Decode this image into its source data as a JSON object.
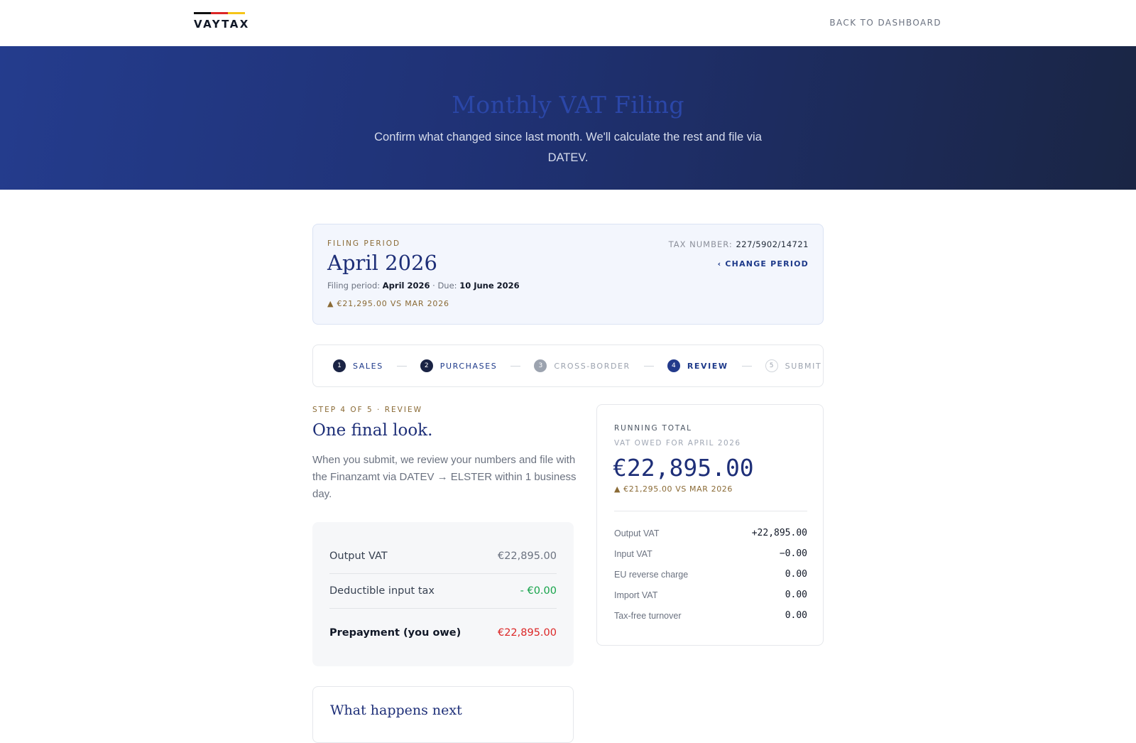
{
  "brand": {
    "name": "VAYTAX",
    "stripe_colors": [
      "#111111",
      "#dc2626",
      "#f5c518"
    ]
  },
  "nav": {
    "back_label": "BACK TO DASHBOARD"
  },
  "hero": {
    "title": "Monthly VAT Filing",
    "subtitle": "Confirm what changed since last month. We'll calculate the rest and file via DATEV."
  },
  "period": {
    "eyebrow": "FILING PERIOD",
    "title": "April 2026",
    "meta_label_period": "Filing period:",
    "meta_value_period": "April 2026",
    "meta_sep": "·",
    "meta_label_due": "Due:",
    "meta_value_due": "10 June 2026",
    "delta": "▲ €21,295.00 VS MAR 2026",
    "tax_number_label": "TAX NUMBER:",
    "tax_number_value": "227/5902/14721",
    "change_label": "‹ CHANGE PERIOD"
  },
  "stepper": {
    "steps": [
      {
        "num": "1",
        "label": "SALES",
        "state": "done"
      },
      {
        "num": "2",
        "label": "PURCHASES",
        "state": "done"
      },
      {
        "num": "3",
        "label": "CROSS-BORDER",
        "state": "pending"
      },
      {
        "num": "4",
        "label": "REVIEW",
        "state": "current"
      },
      {
        "num": "5",
        "label": "SUBMIT",
        "state": "future"
      }
    ]
  },
  "review": {
    "eyebrow": "STEP 4 OF 5 · REVIEW",
    "title": "One final look.",
    "description": "When you submit, we review your numbers and file with the Finanzamt via DATEV → ELSTER within 1 business day.",
    "summary": {
      "output_label": "Output VAT",
      "output_value": "€22,895.00",
      "input_label": "Deductible input tax",
      "input_value": "- €0.00",
      "total_label": "Prepayment (you owe)",
      "total_value": "€22,895.00"
    },
    "next_title": "What happens next"
  },
  "running_total": {
    "label": "RUNNING TOTAL",
    "sublabel": "VAT OWED FOR APRIL 2026",
    "amount": "€22,895.00",
    "delta": "▲ €21,295.00 VS MAR 2026",
    "rows": [
      {
        "label": "Output VAT",
        "value": "+22,895.00"
      },
      {
        "label": "Input VAT",
        "value": "−0.00"
      },
      {
        "label": "EU reverse charge",
        "value": "0.00"
      },
      {
        "label": "Import VAT",
        "value": "0.00"
      },
      {
        "label": "Tax-free turnover",
        "value": "0.00"
      }
    ]
  }
}
